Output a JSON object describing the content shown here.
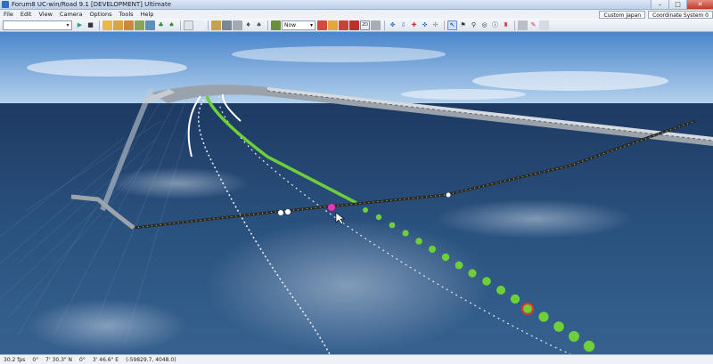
{
  "window": {
    "title": "Forum8 UC-win/Road 9.1 [DEVELOPMENT] Ultimate",
    "minimize": "–",
    "maximize": "□",
    "close": "✕"
  },
  "menu": {
    "items": [
      "File",
      "Edit",
      "View",
      "Camera",
      "Options",
      "Tools",
      "Help"
    ],
    "custom_label": "Custom Japan",
    "coord_label": "Coordinate System 0"
  },
  "toolbar": {
    "time_select": "Now",
    "icons": [
      "play-icon",
      "stop-icon",
      "scenario-icon",
      "car-icon",
      "road-icon",
      "terrain-icon",
      "people-icon",
      "tree-icon",
      "view-icon",
      "camera-icon",
      "landscape-icon",
      "light-icon",
      "cloud-icon",
      "object-icon",
      "marker-icon",
      "clock-icon",
      "paint-icon",
      "lock-icon",
      "model-icon",
      "record-icon",
      "text-2d-icon",
      "tag-icon",
      "move-icon",
      "rotate-icon",
      "zoom-icon",
      "pan-icon",
      "cursor-icon",
      "flag-icon",
      "pin-icon",
      "circle-icon",
      "info-icon",
      "person-icon",
      "grid-icon",
      "chart-icon",
      "settings-icon"
    ]
  },
  "status": {
    "fps": "30.2 fps",
    "coord_a": "0°",
    "lat": "7' 30.3\" N",
    "zero": "0°",
    "lon": "3' 46.6\" E",
    "xy": "(-59829.7, 4048.0)"
  },
  "colors": {
    "green_path": "#6fcf3a",
    "dark_path": "#2b2b2b",
    "marker_pink": "#d83fb4",
    "marker_red": "#d8392b"
  }
}
